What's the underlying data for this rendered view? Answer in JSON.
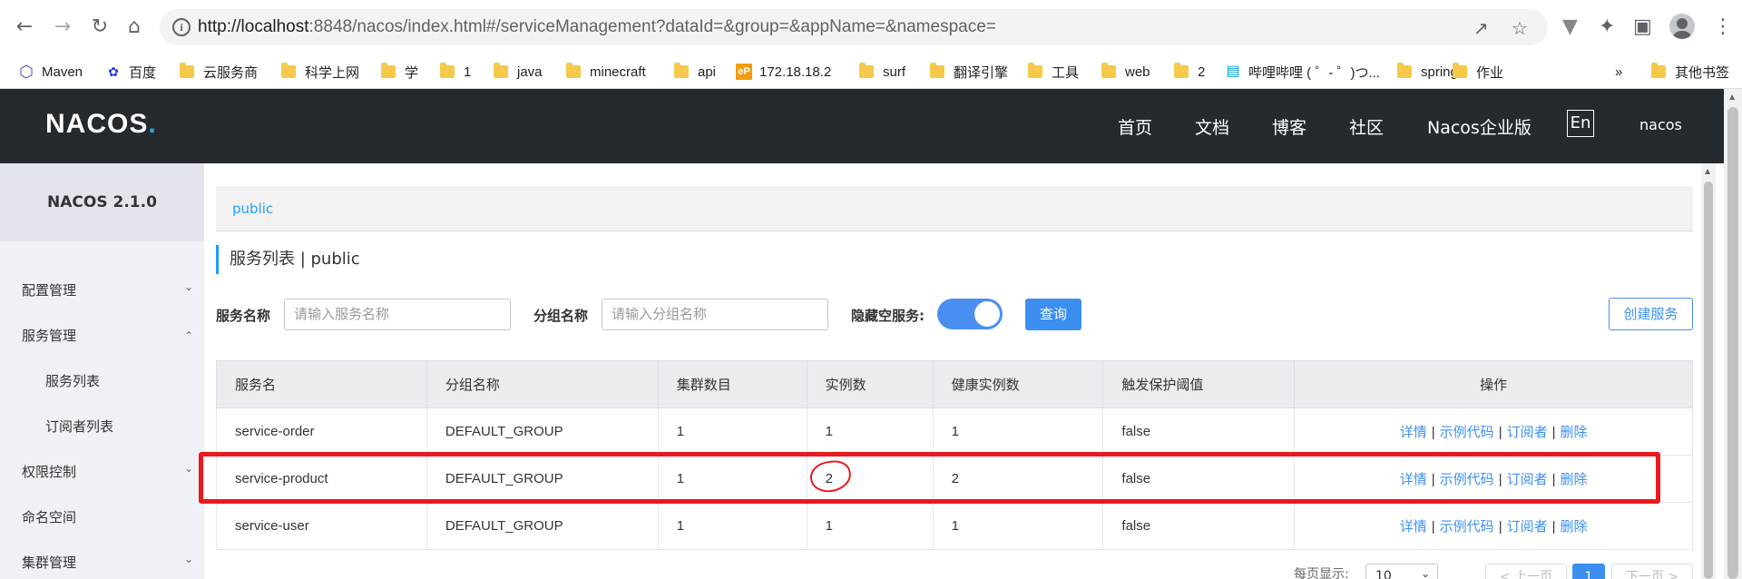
{
  "browser": {
    "url_host": "http://localhost",
    "url_rest": ":8848/nacos/index.html#/serviceManagement?dataId=&group=&appName=&namespace=",
    "bookmarks": [
      {
        "label": "Maven",
        "icon": "hexagon-icon"
      },
      {
        "label": "百度",
        "icon": "paw-icon"
      },
      {
        "label": "云服务商",
        "icon": "folder-icon"
      },
      {
        "label": "科学上网",
        "icon": "folder-icon"
      },
      {
        "label": "学",
        "icon": "folder-icon"
      },
      {
        "label": "1",
        "icon": "folder-icon"
      },
      {
        "label": "java",
        "icon": "folder-icon"
      },
      {
        "label": "minecraft",
        "icon": "folder-icon"
      },
      {
        "label": "api",
        "icon": "folder-icon"
      },
      {
        "label": "172.18.18.2",
        "icon": "ep-icon"
      },
      {
        "label": "surf",
        "icon": "folder-icon"
      },
      {
        "label": "翻译引擎",
        "icon": "folder-icon"
      },
      {
        "label": "工具",
        "icon": "folder-icon"
      },
      {
        "label": "web",
        "icon": "folder-icon"
      },
      {
        "label": "2",
        "icon": "folder-icon"
      },
      {
        "label": "哔哩哔哩 ( ゜- ゜)つ...",
        "icon": "bilibili-icon"
      },
      {
        "label": "spring",
        "icon": "folder-icon"
      },
      {
        "label": "作业",
        "icon": "folder-icon"
      }
    ],
    "more": "»",
    "other_bookmarks": "其他书签"
  },
  "header": {
    "logo_left": "NA",
    "logo_mid": "COS",
    "logo_dot": ".",
    "nav": [
      "首页",
      "文档",
      "博客",
      "社区",
      "Nacos企业版"
    ],
    "lang": "En",
    "user": "nacos"
  },
  "sidebar": {
    "version": "NACOS 2.1.0",
    "items": [
      {
        "label": "配置管理",
        "chevron": "down"
      },
      {
        "label": "服务管理",
        "chevron": "up"
      },
      {
        "label": "服务列表",
        "sub": true
      },
      {
        "label": "订阅者列表",
        "sub": true
      },
      {
        "label": "权限控制",
        "chevron": "down"
      },
      {
        "label": "命名空间"
      },
      {
        "label": "集群管理",
        "chevron": "down"
      }
    ]
  },
  "main": {
    "namespace": "public",
    "title": "服务列表  |  public",
    "filters": {
      "service_label": "服务名称",
      "service_placeholder": "请输入服务名称",
      "group_label": "分组名称",
      "group_placeholder": "请输入分组名称",
      "hide_empty_label": "隐藏空服务:",
      "query_button": "查询",
      "create_button": "创建服务"
    },
    "table": {
      "headers": [
        "服务名",
        "分组名称",
        "集群数目",
        "实例数",
        "健康实例数",
        "触发保护阈值",
        "操作"
      ],
      "rows": [
        [
          "service-order",
          "DEFAULT_GROUP",
          "1",
          "1",
          "1",
          "false"
        ],
        [
          "service-product",
          "DEFAULT_GROUP",
          "1",
          "2",
          "2",
          "false"
        ],
        [
          "service-user",
          "DEFAULT_GROUP",
          "1",
          "1",
          "1",
          "false"
        ]
      ],
      "actions": [
        "详情",
        "示例代码",
        "订阅者",
        "删除"
      ]
    },
    "pagination": {
      "page_size_label": "每页显示:",
      "page_size": "10",
      "prev": "< 上一页",
      "current": "1",
      "next": "下一页 >"
    }
  },
  "colors": {
    "header_bg": "#252a2f",
    "accent": "#3c8ff1",
    "annotation": "#e8191f"
  }
}
